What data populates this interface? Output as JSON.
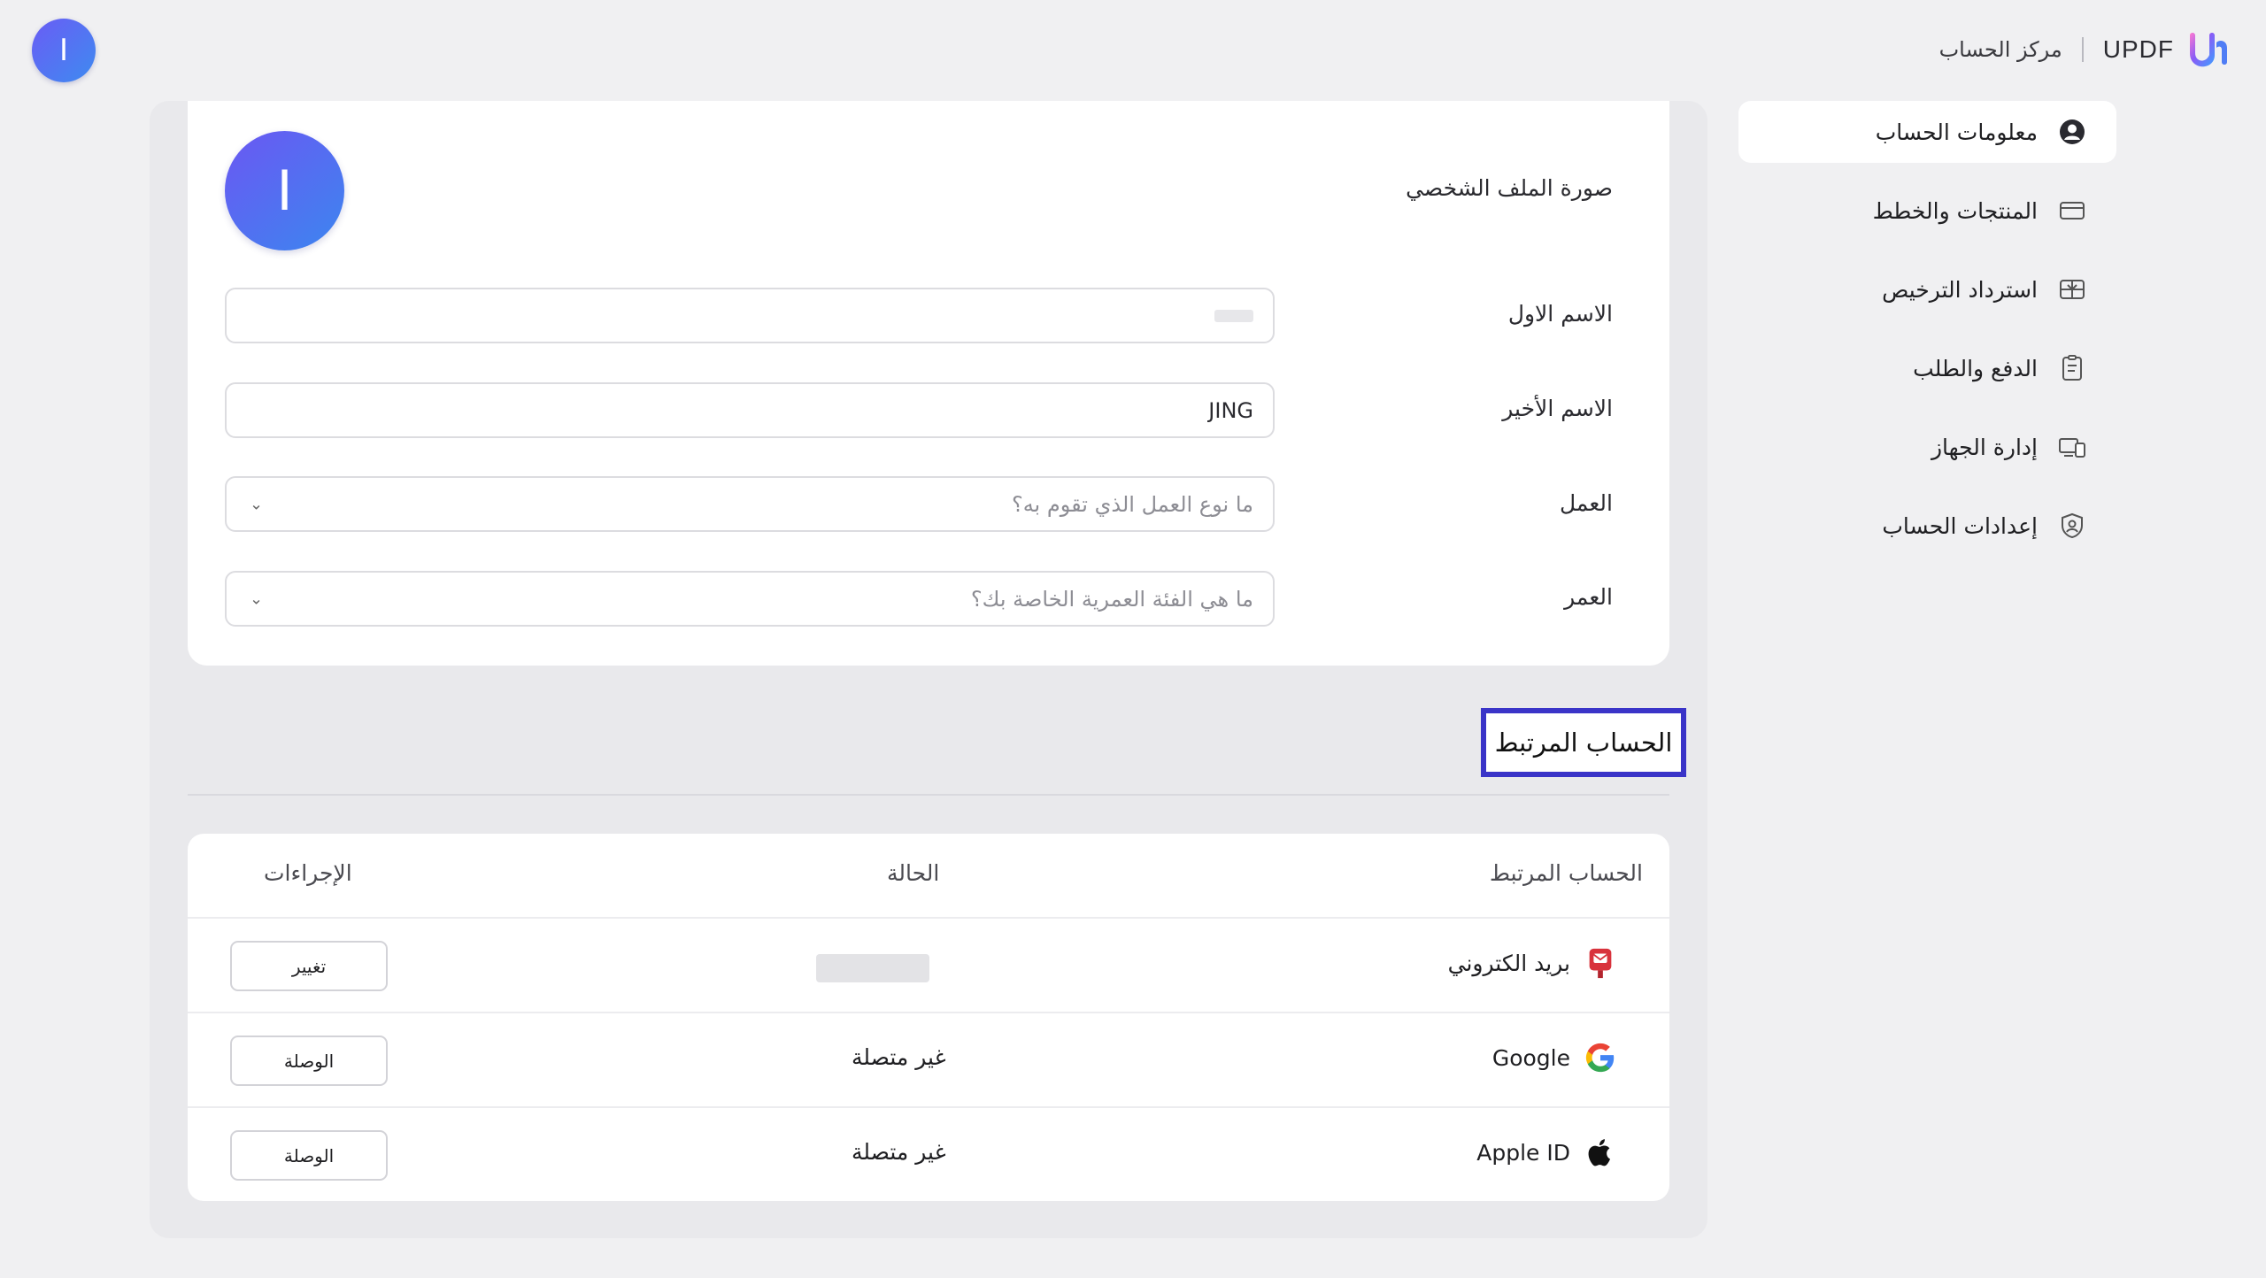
{
  "header": {
    "avatar_initial": "I",
    "brand_name": "UPDF",
    "center_title": "مركز الحساب",
    "accent": "#5b4ef0"
  },
  "sidebar": {
    "items": [
      {
        "label": "معلومات الحساب",
        "icon": "user-circle-icon",
        "active": true
      },
      {
        "label": "المنتجات والخطط",
        "icon": "card-icon",
        "active": false
      },
      {
        "label": "استرداد الترخيص",
        "icon": "gift-icon",
        "active": false
      },
      {
        "label": "الدفع والطلب",
        "icon": "clipboard-icon",
        "active": false
      },
      {
        "label": "إدارة الجهاز",
        "icon": "devices-icon",
        "active": false
      },
      {
        "label": "إعدادات الحساب",
        "icon": "shield-user-icon",
        "active": false
      }
    ]
  },
  "profile": {
    "photo_label": "صورة الملف الشخصي",
    "photo_initial": "I",
    "first_name_label": "الاسم الاول",
    "first_name_value": "",
    "last_name_label": "الاسم الأخير",
    "last_name_value": "JING",
    "job_label": "العمل",
    "job_placeholder": "ما نوع العمل الذي تقوم به؟",
    "age_label": "العمر",
    "age_placeholder": "ما هي الفئة العمرية الخاصة بك؟"
  },
  "linked": {
    "section_title": "الحساب المرتبط",
    "headers": {
      "account": "الحساب المرتبط",
      "status": "الحالة",
      "actions": "الإجراءات"
    },
    "rows": [
      {
        "name": "بريد الكتروني",
        "icon": "mail-icon",
        "status": "",
        "action": "تغيير"
      },
      {
        "name": "Google",
        "icon": "google-icon",
        "status": "غير متصلة",
        "action": "الوصلة"
      },
      {
        "name": "Apple ID",
        "icon": "apple-icon",
        "status": "غير متصلة",
        "action": "الوصلة"
      }
    ]
  }
}
